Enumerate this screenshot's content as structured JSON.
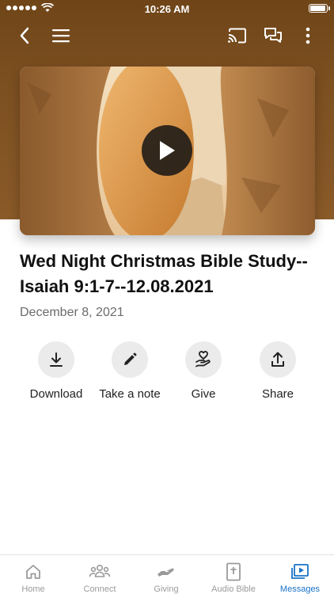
{
  "status_bar": {
    "time": "10:26 AM",
    "battery_level": 1.0
  },
  "nav": {
    "back_icon": "chevron-left-icon",
    "menu_icon": "hamburger-menu-icon",
    "cast_icon": "cast-icon",
    "chat_icon": "chat-bubbles-icon",
    "more_icon": "more-vertical-icon"
  },
  "colors": {
    "header_brown": "#7d5021",
    "active_tab": "#1a73c8",
    "inactive_tab": "#9a9a9a"
  },
  "message": {
    "title": "Wed Night Christmas Bible Study--Isaiah 9:1-7--12.08.2021",
    "date": "December 8, 2021"
  },
  "actions": [
    {
      "label": "Download",
      "icon": "download-icon"
    },
    {
      "label": "Take a note",
      "icon": "pencil-icon"
    },
    {
      "label": "Give",
      "icon": "heart-hand-icon"
    },
    {
      "label": "Share",
      "icon": "share-icon"
    }
  ],
  "tabs": [
    {
      "label": "Home",
      "icon": "home-icon",
      "active": false
    },
    {
      "label": "Connect",
      "icon": "people-icon",
      "active": false
    },
    {
      "label": "Giving",
      "icon": "giving-hand-icon",
      "active": false
    },
    {
      "label": "Audio Bible",
      "icon": "bible-icon",
      "active": false
    },
    {
      "label": "Messages",
      "icon": "play-messages-icon",
      "active": true
    }
  ]
}
